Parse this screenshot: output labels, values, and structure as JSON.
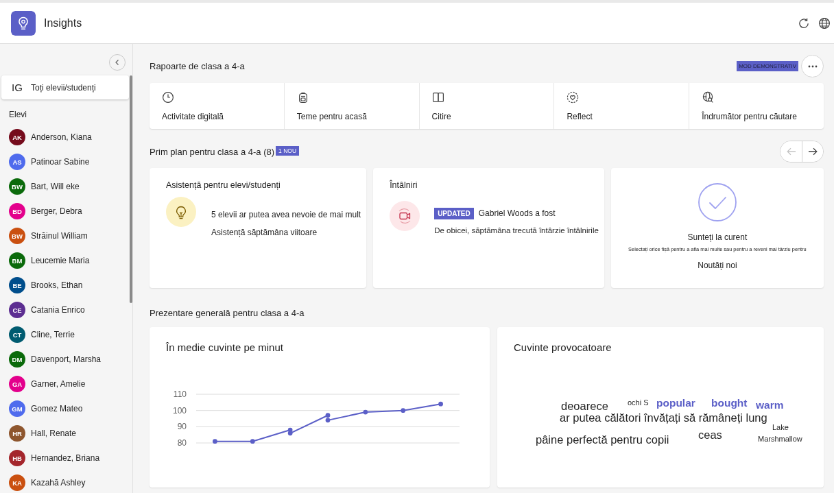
{
  "header": {
    "title": "Insights"
  },
  "sidebar": {
    "all_students": {
      "initials": "IG",
      "label": "Toți elevii/studenți",
      "selected": true
    },
    "section_label": "Elevi",
    "students": [
      {
        "initials": "AK",
        "name": "Anderson, Kiana",
        "color": "#750b1c",
        "selected": false
      },
      {
        "initials": "AS",
        "name": "Patinoar Sabine",
        "color": "#4f6bed",
        "selected": false
      },
      {
        "initials": "BW",
        "name": "Bart, Will eke",
        "color": "#0b6a0b",
        "selected": false
      },
      {
        "initials": "BD",
        "name": "Berger, Debra",
        "color": "#e3008c",
        "selected": false
      },
      {
        "initials": "BW",
        "name": "Străinul William",
        "color": "#ca5010",
        "selected": false
      },
      {
        "initials": "BM",
        "name": "Leucemie Maria",
        "color": "#0b6a0b",
        "selected": false
      },
      {
        "initials": "BE",
        "name": "Brooks, Ethan",
        "color": "#004e8c",
        "selected": false
      },
      {
        "initials": "CE",
        "name": "Catania Enrico",
        "color": "#5c2e91",
        "selected": false
      },
      {
        "initials": "CT",
        "name": "Cline, Terrie",
        "color": "#005b70",
        "selected": false
      },
      {
        "initials": "DM",
        "name": "Davenport, Marsha",
        "color": "#0b6a0b",
        "selected": false
      },
      {
        "initials": "GA",
        "name": "Garner, Amelie",
        "color": "#e3008c",
        "selected": false
      },
      {
        "initials": "GM",
        "name": "Gomez Mateo",
        "color": "#4f6bed",
        "selected": false
      },
      {
        "initials": "HR",
        "name": "Hall, Renate",
        "color": "#8e562e",
        "selected": false
      },
      {
        "initials": "HB",
        "name": "Hernandez, Briana",
        "color": "#a4262c",
        "selected": false
      },
      {
        "initials": "KA",
        "name": "Kazahă Ashley",
        "color": "#ca5010",
        "selected": false
      }
    ]
  },
  "reports": {
    "title": "Rapoarte de clasa a 4-a",
    "badge": "MOD DEMONSTRATIV",
    "items": [
      {
        "label": "Activitate digitală"
      },
      {
        "label": "Teme pentru acasă"
      },
      {
        "label": "Citire"
      },
      {
        "label": "Reflect"
      },
      {
        "label": "Îndrumător pentru căutare"
      }
    ]
  },
  "spotlight": {
    "title": "Prim plan pentru clasa a 4-a (8)",
    "badge": "1 NOU",
    "nav": [
      {
        "disabled": true
      },
      {
        "disabled": false
      }
    ],
    "cards": [
      {
        "kind": "support",
        "title": "Asistență pentru elevi/studenți",
        "lines": [
          "5 elevii ar putea avea nevoie de mai mult",
          "Asistență săptămâna viitoare"
        ]
      },
      {
        "kind": "meetings",
        "title": "Întâlniri",
        "tag": "UPDATED",
        "lines": [
          "Gabriel Woods a fost",
          "De obicei, săptămâna trecută întârzie întâlnirile"
        ]
      },
      {
        "kind": "status",
        "heading": "Sunteți la curent",
        "note": "Selectați orice fișă pentru a afla mai multe sau pentru a reveni mai târziu pentru",
        "footer": "Noutăți noi"
      }
    ]
  },
  "overview": {
    "title": "Prezentare generală pentru clasa a 4-a",
    "wpm": {
      "chart_data": {
        "type": "line",
        "title": "În medie cuvinte pe minut",
        "series": [
          {
            "color": "#5b5fc7",
            "marker": "o",
            "values": [
              81,
              81,
              88,
              null,
              null,
              null,
              null
            ]
          },
          {
            "color": "#5b5fc7",
            "marker": "o",
            "values": [
              null,
              null,
              86,
              97,
              null,
              null,
              null
            ]
          },
          {
            "color": "#5b5fc7",
            "marker": "o",
            "values": [
              null,
              null,
              null,
              94,
              99,
              100,
              104
            ]
          }
        ],
        "ylim": [
          80,
          110
        ],
        "yticks": [
          80,
          90,
          100,
          110
        ]
      }
    },
    "words": {
      "title": "Cuvinte provocatoare",
      "items": [
        {
          "text": "deoarece",
          "kind": "plain"
        },
        {
          "text": "ochi S",
          "kind": "minor"
        },
        {
          "text": "popular",
          "kind": "accent"
        },
        {
          "text": "bought",
          "kind": "accent"
        },
        {
          "text": "warm",
          "kind": "accent"
        },
        {
          "text": "ar putea călători învățați să rămâneți lung",
          "kind": "plain"
        },
        {
          "text": "Lake",
          "kind": "minor"
        },
        {
          "text": "pâine perfectă pentru copii",
          "kind": "plain"
        },
        {
          "text": "ceas",
          "kind": "plain"
        },
        {
          "text": "Marshmallow",
          "kind": "minor"
        }
      ]
    }
  }
}
